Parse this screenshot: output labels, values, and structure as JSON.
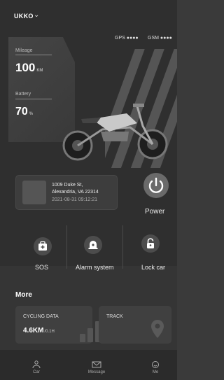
{
  "header": {
    "vehicle_name": "UKKO"
  },
  "signals": {
    "gps_label": "GPS",
    "gsm_label": "GSM",
    "gps_dots": "●●●●",
    "gsm_dots": "●●●●"
  },
  "metrics": {
    "mileage": {
      "label": "Mileage",
      "value": "100",
      "unit": "KM"
    },
    "battery": {
      "label": "Battery",
      "value": "70",
      "unit": "%"
    }
  },
  "location": {
    "street": "1009 Duke St,",
    "city": "Alexandria, VA 22314",
    "timestamp": "2021-08-31 09:12:21"
  },
  "actions": {
    "power": "Power",
    "sos": "SOS",
    "alarm": "Alarm system",
    "lock": "Lock car"
  },
  "more": {
    "title": "More",
    "cycling": {
      "title": "CYCLING DATA",
      "value": "4.6KM",
      "sub": "/0.1H"
    },
    "track": {
      "title": "TRACK"
    }
  },
  "tabs": {
    "car": "Car",
    "message": "Message",
    "me": "Me"
  },
  "colors": {
    "background": "#2f2f2f",
    "card": "#3d3d3d",
    "text": "#ffffff"
  }
}
